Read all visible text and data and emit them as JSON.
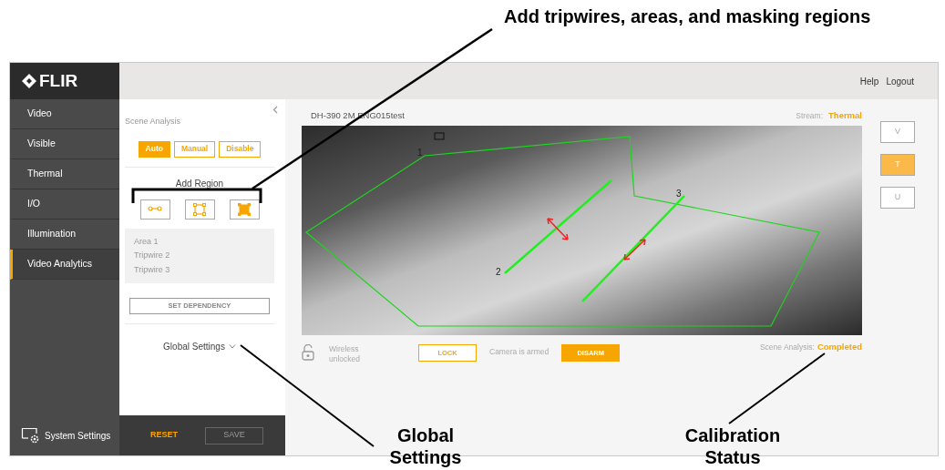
{
  "annotations": [
    {
      "text": "Add tripwires, areas, and masking regions"
    },
    {
      "text": "Global Settings"
    },
    {
      "text": "Calibration Status"
    }
  ],
  "logo": {
    "text": "FLIR"
  },
  "header_links": [
    "Help",
    "Logout"
  ],
  "nav": [
    {
      "label": "Video",
      "selected": false
    },
    {
      "label": "Visible",
      "selected": false
    },
    {
      "label": "Thermal",
      "selected": false
    },
    {
      "label": "I/O",
      "selected": false
    },
    {
      "label": "Illumination",
      "selected": false
    },
    {
      "label": "Video Analytics",
      "selected": true
    }
  ],
  "system_settings": "System Settings",
  "panel": {
    "title": "Scene Analysis",
    "modes": [
      {
        "label": "Auto",
        "selected": true
      },
      {
        "label": "Manual",
        "selected": false
      },
      {
        "label": "Disable",
        "selected": false
      }
    ],
    "add_region_label": "Add Region",
    "region_tools": [
      {
        "kind": "tripwire"
      },
      {
        "kind": "area"
      },
      {
        "kind": "mask"
      }
    ],
    "regions": [
      "Area 1",
      "Tripwire 2",
      "Tripwire 3"
    ],
    "dependency_button": "SET DEPENDENCY",
    "global_settings": {
      "label": "Global Settings",
      "expanded": false
    }
  },
  "footer": {
    "reset": "RESET",
    "save": {
      "label": "SAVE",
      "disabled": true
    }
  },
  "camera": {
    "name": "DH-390 2M ENG015test",
    "stream_label": "Stream:",
    "stream": "Thermal",
    "overlay_labels": [
      "1",
      "2",
      "3"
    ]
  },
  "stream_buttons": [
    {
      "label": "V",
      "selected": false
    },
    {
      "label": "T",
      "selected": true
    },
    {
      "label": "U",
      "selected": false
    }
  ],
  "status": {
    "wireless": "Wireless unlocked",
    "lock_button": "LOCK",
    "armed": "Camera is armed",
    "disarm_button": "DISARM",
    "scene_label": "Scene Analysis:",
    "scene_status": "Completed"
  }
}
